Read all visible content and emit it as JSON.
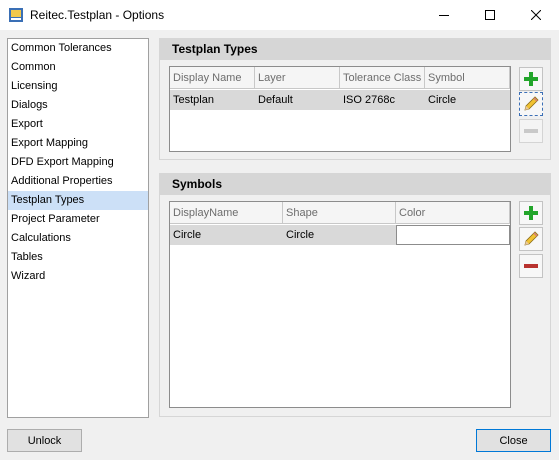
{
  "window": {
    "title": "Reitec.Testplan - Options",
    "controls": {
      "minimize_icon": "minimize-icon",
      "maximize_icon": "maximize-icon",
      "close_icon": "close-icon"
    }
  },
  "nav": {
    "selected": "Testplan Types",
    "items": [
      "Common Tolerances",
      "Common",
      "Licensing",
      "Dialogs",
      "Export",
      "Export Mapping",
      "DFD Export Mapping",
      "Additional Properties",
      "Testplan Types",
      "Project Parameter",
      "Calculations",
      "Tables",
      "Wizard"
    ]
  },
  "testplan_types": {
    "header": "Testplan Types",
    "columns": [
      "Display Name",
      "Layer",
      "Tolerance Class",
      "Symbol"
    ],
    "rows": [
      [
        "Testplan",
        "Default",
        "ISO 2768c",
        "Circle"
      ]
    ]
  },
  "symbols": {
    "header": "Symbols",
    "columns": [
      "DisplayName",
      "Shape",
      "Color"
    ],
    "rows": [
      [
        "Circle",
        "Circle",
        ""
      ]
    ]
  },
  "buttons": {
    "unlock": "Unlock",
    "close": "Close"
  },
  "colors": {
    "add": "#22a52a",
    "remove": "#b8322e",
    "selection": "#cce0f7"
  }
}
